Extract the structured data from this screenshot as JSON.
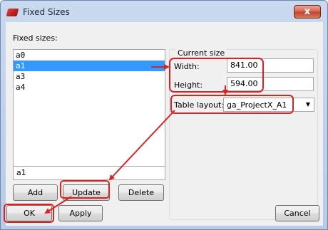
{
  "window": {
    "title": "Fixed Sizes",
    "close_label": "x"
  },
  "left": {
    "list_label": "Fixed sizes:",
    "items": [
      "a0",
      "a1",
      "a3",
      "a4"
    ],
    "selected_index": 1,
    "name_value": "a1",
    "add_label": "Add",
    "update_label": "Update",
    "delete_label": "Delete"
  },
  "current_size": {
    "group_label": "Current size",
    "width_label": "Width:",
    "width_value": "841.00",
    "height_label": "Height:",
    "height_value": "594.00",
    "layout_label": "Table layout:",
    "layout_value": "ga_ProjectX_A1"
  },
  "footer": {
    "ok_label": "OK",
    "apply_label": "Apply",
    "cancel_label": "Cancel"
  },
  "colors": {
    "annotation": "#e02020",
    "selection": "#3399ff"
  }
}
